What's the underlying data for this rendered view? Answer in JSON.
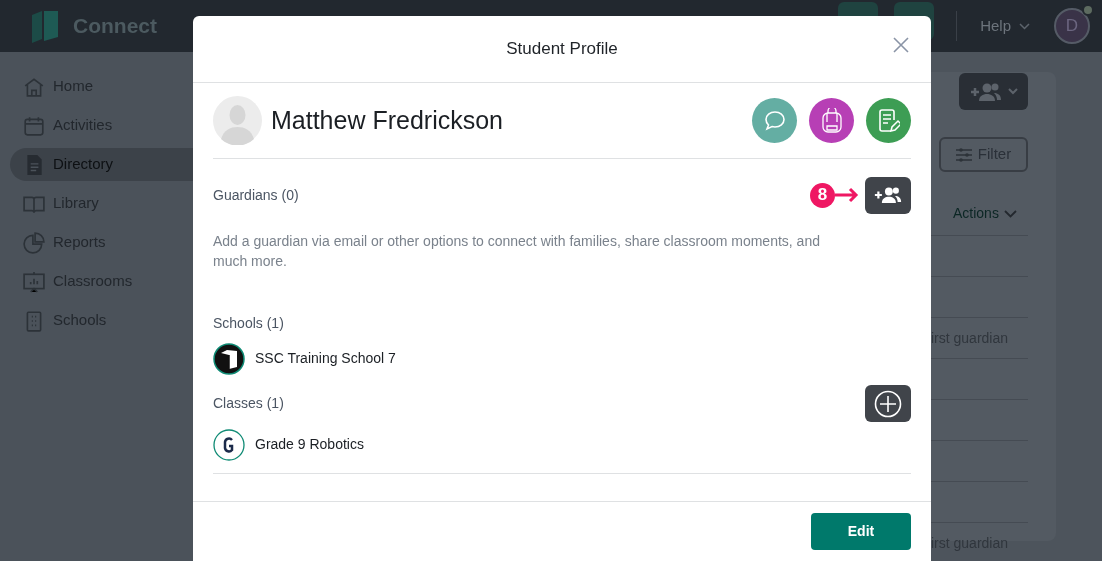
{
  "app": {
    "logo": "Connect",
    "help_menu": "Help",
    "avatar_initial": "D",
    "nav": [
      {
        "label": "Home",
        "selected": false
      },
      {
        "label": "Activities",
        "selected": false
      },
      {
        "label": "Directory",
        "selected": true
      },
      {
        "label": "Library",
        "selected": false
      },
      {
        "label": "Reports",
        "selected": false
      },
      {
        "label": "Classrooms",
        "selected": false
      },
      {
        "label": "Schools",
        "selected": false
      }
    ]
  },
  "background_panel": {
    "filter_button": "Filter",
    "actions_menu": "Actions",
    "row_texts": [
      "irst guardian",
      "irst guardian"
    ]
  },
  "modal": {
    "title": "Student Profile",
    "student_name": "Matthew Fredrickson",
    "guardians": {
      "heading": "Guardians (0)",
      "description": "Add a guardian via email or other options to connect with families, share classroom moments, and much more."
    },
    "annotation": "8",
    "schools": {
      "heading": "Schools (1)",
      "items": [
        "SSC Training School 7"
      ]
    },
    "classes": {
      "heading": "Classes (1)",
      "items": [
        "Grade 9 Robotics"
      ]
    },
    "edit_button": "Edit"
  }
}
